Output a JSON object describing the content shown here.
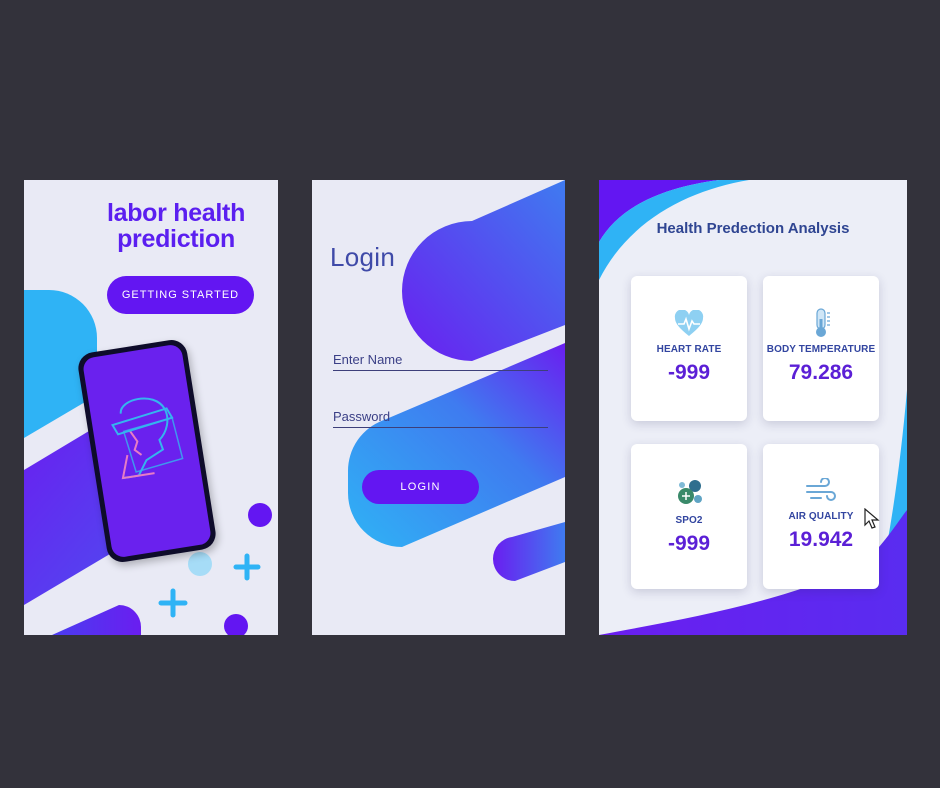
{
  "splash": {
    "title_line1": "labor health",
    "title_line2": "prediction",
    "button_label": "GETTING STARTED"
  },
  "login": {
    "title": "Login",
    "name_placeholder": "Enter Name",
    "password_placeholder": "Password",
    "button_label": "LOGIN"
  },
  "dashboard": {
    "title": "Health Predection Analysis",
    "cards": [
      {
        "label": "HEART RATE",
        "value": "-999",
        "icon": "heart-rate-icon"
      },
      {
        "label": "BODY TEMPERATURE",
        "value": "79.286",
        "icon": "thermometer-icon"
      },
      {
        "label": "SPO2",
        "value": "-999",
        "icon": "oxygen-bubbles-icon"
      },
      {
        "label": "AIR QUALITY",
        "value": "19.942",
        "icon": "wind-icon"
      }
    ]
  },
  "colors": {
    "background": "#33323b",
    "panel": "#e9eaf5",
    "primary_purple": "#6316f2",
    "accent_blue": "#2fb3f5",
    "title_navy": "#2f4592"
  }
}
